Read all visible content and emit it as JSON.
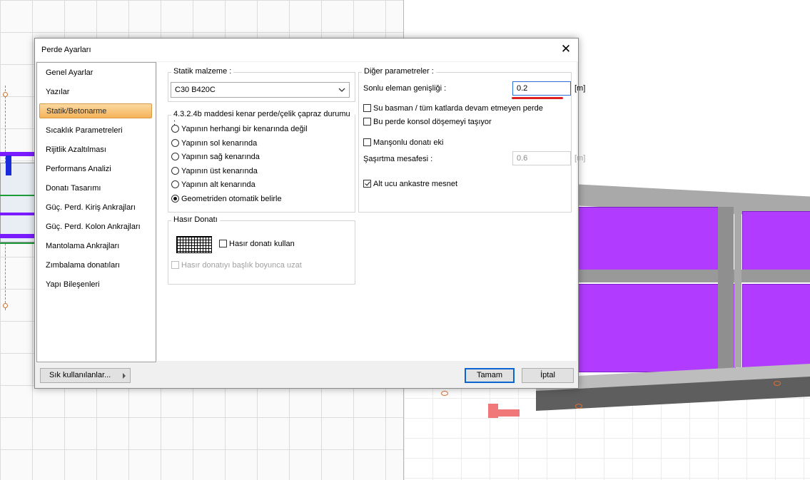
{
  "dialog": {
    "title": "Perde Ayarları",
    "close_symbol": "✕"
  },
  "nav": {
    "items": [
      {
        "label": "Genel Ayarlar"
      },
      {
        "label": "Yazılar"
      },
      {
        "label": "Statik/Betonarme"
      },
      {
        "label": "Sıcaklık Parametreleri"
      },
      {
        "label": "Rijitlik Azaltılması"
      },
      {
        "label": "Performans Analizi"
      },
      {
        "label": "Donatı Tasarımı"
      },
      {
        "label": "Güç. Perd. Kiriş Ankrajları"
      },
      {
        "label": "Güç. Perd. Kolon Ankrajları"
      },
      {
        "label": "Mantolama Ankrajları"
      },
      {
        "label": "Zımbalama donatıları"
      },
      {
        "label": "Yapı Bileşenleri"
      }
    ],
    "selected": "Statik/Betonarme"
  },
  "static_material": {
    "group_label": "Statik malzeme :",
    "value": "C30 B420C"
  },
  "edge_condition": {
    "group_label": "4.3.2.4b maddesi kenar perde/çelik çapraz durumu :",
    "options": [
      {
        "label": "Yapının herhangi bir kenarında değil",
        "checked": false
      },
      {
        "label": "Yapının sol kenarında",
        "checked": false
      },
      {
        "label": "Yapının sağ kenarında",
        "checked": false
      },
      {
        "label": "Yapının üst kenarında",
        "checked": false
      },
      {
        "label": "Yapının alt kenarında",
        "checked": false
      },
      {
        "label": "Geometriden otomatik belirle",
        "checked": true
      }
    ]
  },
  "mesh": {
    "group_label": "Hasır Donatı",
    "use_label": "Hasır donatı kullan",
    "use_checked": false,
    "extend_label": "Hasır donatıyı başlık boyunca uzat",
    "extend_checked": false
  },
  "other": {
    "group_label": "Diğer parametreler :",
    "end_width_label": "Sonlu eleman genişliği :",
    "end_width_value": "0.2",
    "end_width_unit": "[m]",
    "basement_label": "Su basman / tüm katlarda devam etmeyen perde",
    "basement_checked": false,
    "cantilever_label": "Bu perde konsol döşemeyi taşıyor",
    "cantilever_checked": false,
    "sleeve_label": "Manşonlu donatı eki",
    "sleeve_checked": false,
    "stagger_label": "Şaşırtma mesafesi :",
    "stagger_value": "0.6",
    "stagger_unit": "[m]",
    "fixed_label": "Alt ucu ankastre mesnet",
    "fixed_checked": true
  },
  "footer": {
    "frequent_label": "Sık kullanılanlar...",
    "ok_label": "Tamam",
    "cancel_label": "İptal"
  }
}
